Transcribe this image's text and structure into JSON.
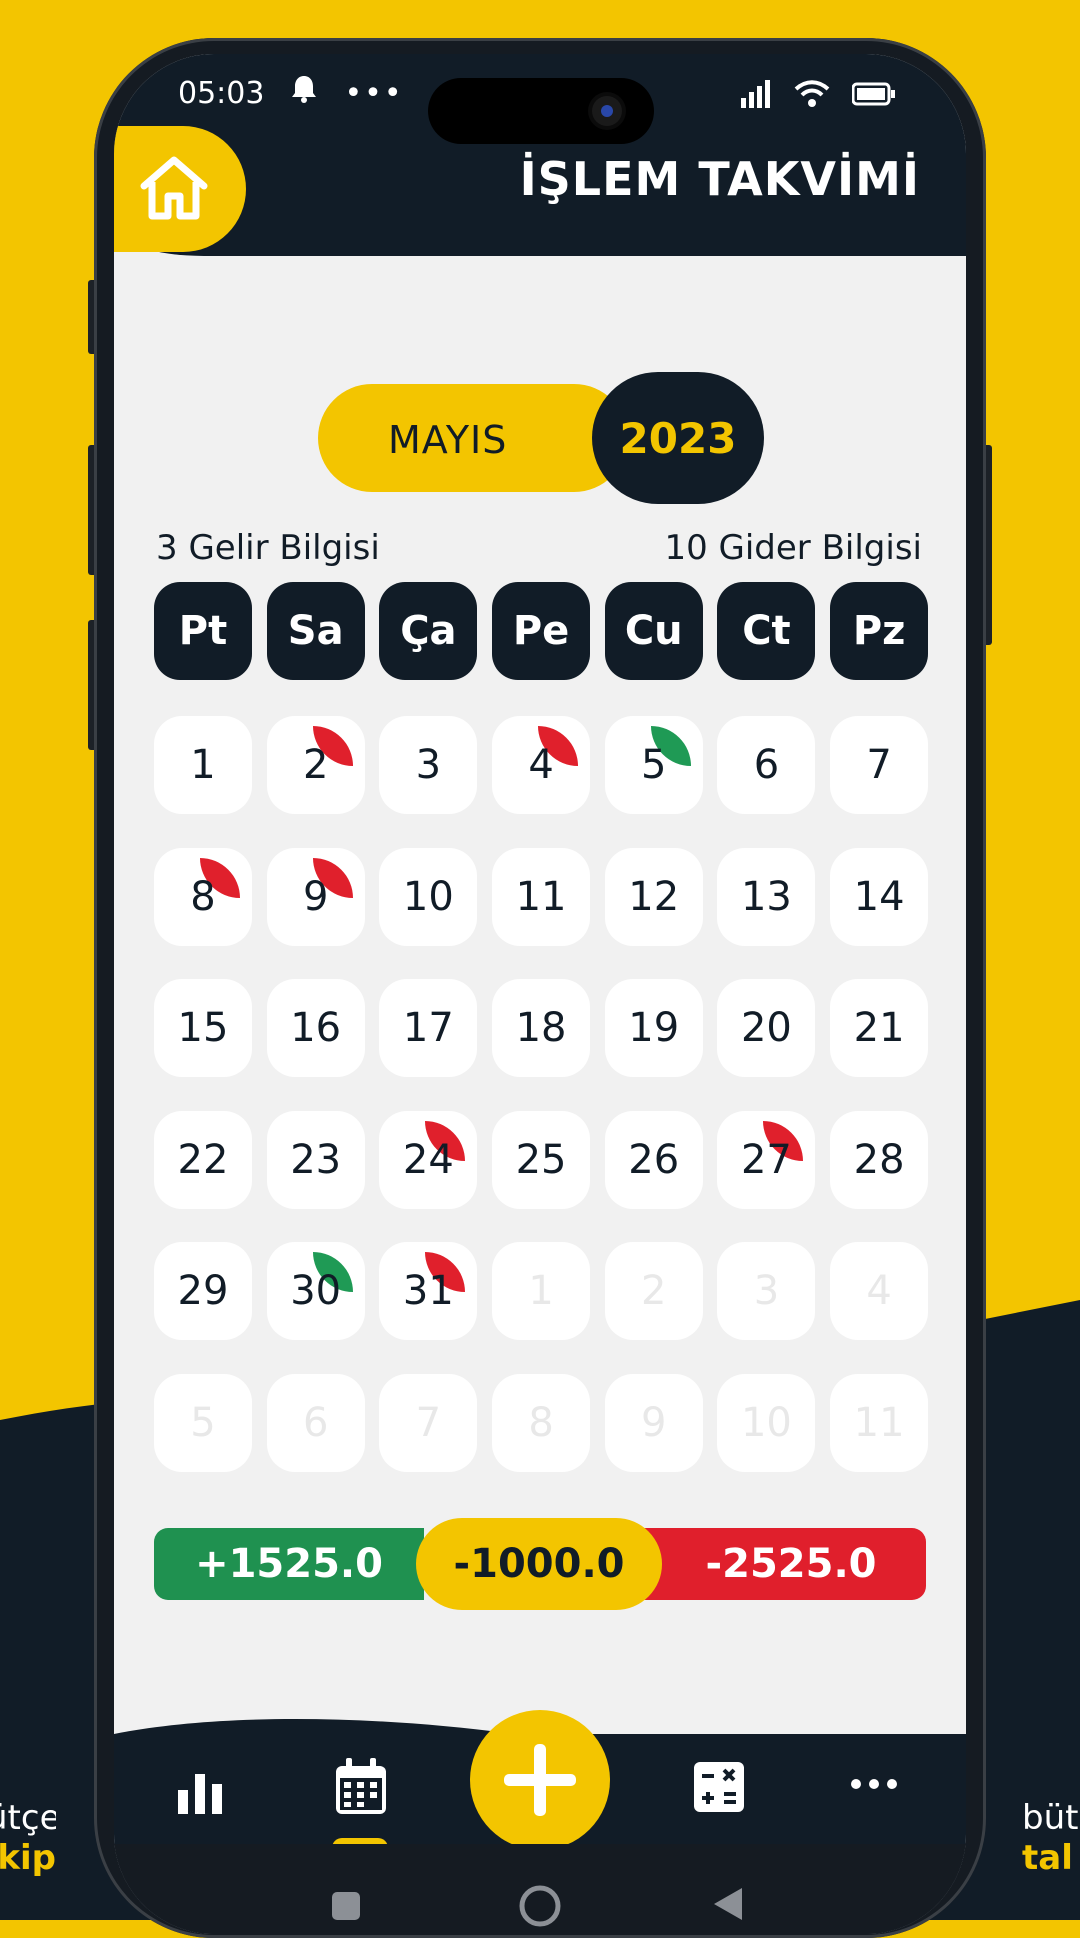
{
  "status_bar": {
    "time": "05:03"
  },
  "header": {
    "title": "İŞLEM TAKVİMİ"
  },
  "period": {
    "month": "MAYIS",
    "year": "2023"
  },
  "info": {
    "income_count": "3 Gelir Bilgisi",
    "expense_count": "10 Gider Bilgisi"
  },
  "weekdays": [
    "Pt",
    "Sa",
    "Ça",
    "Pe",
    "Cu",
    "Ct",
    "Pz"
  ],
  "days": [
    {
      "n": "1"
    },
    {
      "n": "2",
      "mark": "red"
    },
    {
      "n": "3"
    },
    {
      "n": "4",
      "mark": "red"
    },
    {
      "n": "5",
      "mark": "green"
    },
    {
      "n": "6"
    },
    {
      "n": "7"
    },
    {
      "n": "8",
      "mark": "red"
    },
    {
      "n": "9",
      "mark": "red"
    },
    {
      "n": "10"
    },
    {
      "n": "11"
    },
    {
      "n": "12"
    },
    {
      "n": "13"
    },
    {
      "n": "14"
    },
    {
      "n": "15"
    },
    {
      "n": "16"
    },
    {
      "n": "17"
    },
    {
      "n": "18"
    },
    {
      "n": "19"
    },
    {
      "n": "20"
    },
    {
      "n": "21"
    },
    {
      "n": "22"
    },
    {
      "n": "23"
    },
    {
      "n": "24",
      "mark": "red"
    },
    {
      "n": "25"
    },
    {
      "n": "26"
    },
    {
      "n": "27",
      "mark": "red"
    },
    {
      "n": "28"
    },
    {
      "n": "29"
    },
    {
      "n": "30",
      "mark": "green"
    },
    {
      "n": "31",
      "mark": "red"
    },
    {
      "n": "1",
      "dim": true
    },
    {
      "n": "2",
      "dim": true
    },
    {
      "n": "3",
      "dim": true
    },
    {
      "n": "4",
      "dim": true
    },
    {
      "n": "5",
      "dim": true
    },
    {
      "n": "6",
      "dim": true
    },
    {
      "n": "7",
      "dim": true
    },
    {
      "n": "8",
      "dim": true
    },
    {
      "n": "9",
      "dim": true
    },
    {
      "n": "10",
      "dim": true
    },
    {
      "n": "11",
      "dim": true
    }
  ],
  "summary": {
    "income": "+1525.0",
    "balance": "-1000.0",
    "expense": "-2525.0"
  },
  "side_text": {
    "left_top": "ütçe",
    "left_bottom": "kip",
    "right_top": "büt",
    "right_bottom": "tal"
  },
  "colors": {
    "yellow": "#f3c500",
    "navy": "#111c27",
    "green": "#1f9150",
    "red": "#e01f2c"
  },
  "icons": {
    "home": "home-icon",
    "stats": "bar-chart-icon",
    "calendar": "calendar-icon",
    "add": "plus-icon",
    "calculator": "calculator-icon",
    "more": "more-icon"
  }
}
